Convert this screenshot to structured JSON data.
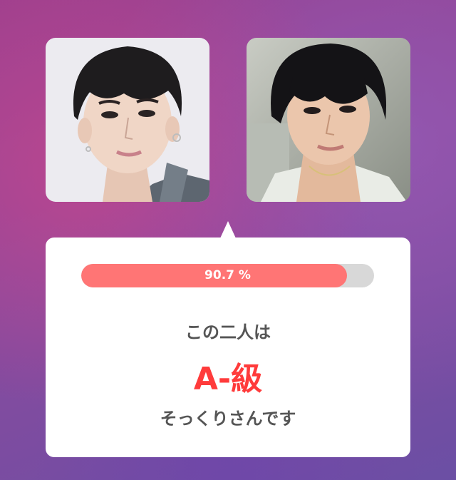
{
  "result": {
    "percent": 90.7,
    "percent_label": "90.7 %",
    "line1": "この二人は",
    "grade": "A-級",
    "line2": "そっくりさんです"
  },
  "photos": [
    {
      "name": "left-person-photo"
    },
    {
      "name": "right-person-photo"
    }
  ],
  "colors": {
    "bar_fill": "#ff7575",
    "bar_track": "#d8d8d8",
    "grade_text": "#ff3b3b",
    "body_text": "#555555"
  }
}
